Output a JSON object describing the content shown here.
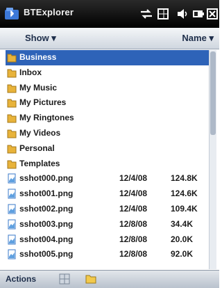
{
  "app": {
    "title": "BTExplorer"
  },
  "status_icons": [
    "sync-icon",
    "signal-icon",
    "speaker-icon",
    "battery-icon",
    "close-icon"
  ],
  "toolbar": {
    "filter_label": "Show",
    "sort_label": "Name"
  },
  "list": {
    "items": [
      {
        "name": "Business",
        "type": "folder",
        "selected": true,
        "date": "",
        "size": ""
      },
      {
        "name": "Inbox",
        "type": "folder",
        "date": "",
        "size": ""
      },
      {
        "name": "My Music",
        "type": "folder",
        "date": "",
        "size": ""
      },
      {
        "name": "My Pictures",
        "type": "folder",
        "date": "",
        "size": ""
      },
      {
        "name": "My Ringtones",
        "type": "folder",
        "date": "",
        "size": ""
      },
      {
        "name": "My Videos",
        "type": "folder",
        "date": "",
        "size": ""
      },
      {
        "name": "Personal",
        "type": "folder",
        "date": "",
        "size": ""
      },
      {
        "name": "Templates",
        "type": "folder",
        "date": "",
        "size": ""
      },
      {
        "name": "sshot000.png",
        "type": "image",
        "date": "12/4/08",
        "size": "124.8K"
      },
      {
        "name": "sshot001.png",
        "type": "image",
        "date": "12/4/08",
        "size": "124.6K"
      },
      {
        "name": "sshot002.png",
        "type": "image",
        "date": "12/4/08",
        "size": "109.4K"
      },
      {
        "name": "sshot003.png",
        "type": "image",
        "date": "12/8/08",
        "size": "34.4K"
      },
      {
        "name": "sshot004.png",
        "type": "image",
        "date": "12/8/08",
        "size": "20.0K"
      },
      {
        "name": "sshot005.png",
        "type": "image",
        "date": "12/8/08",
        "size": "92.0K"
      }
    ]
  },
  "bottombar": {
    "actions_label": "Actions",
    "icons": [
      "grid-icon",
      "folder-icon"
    ]
  }
}
